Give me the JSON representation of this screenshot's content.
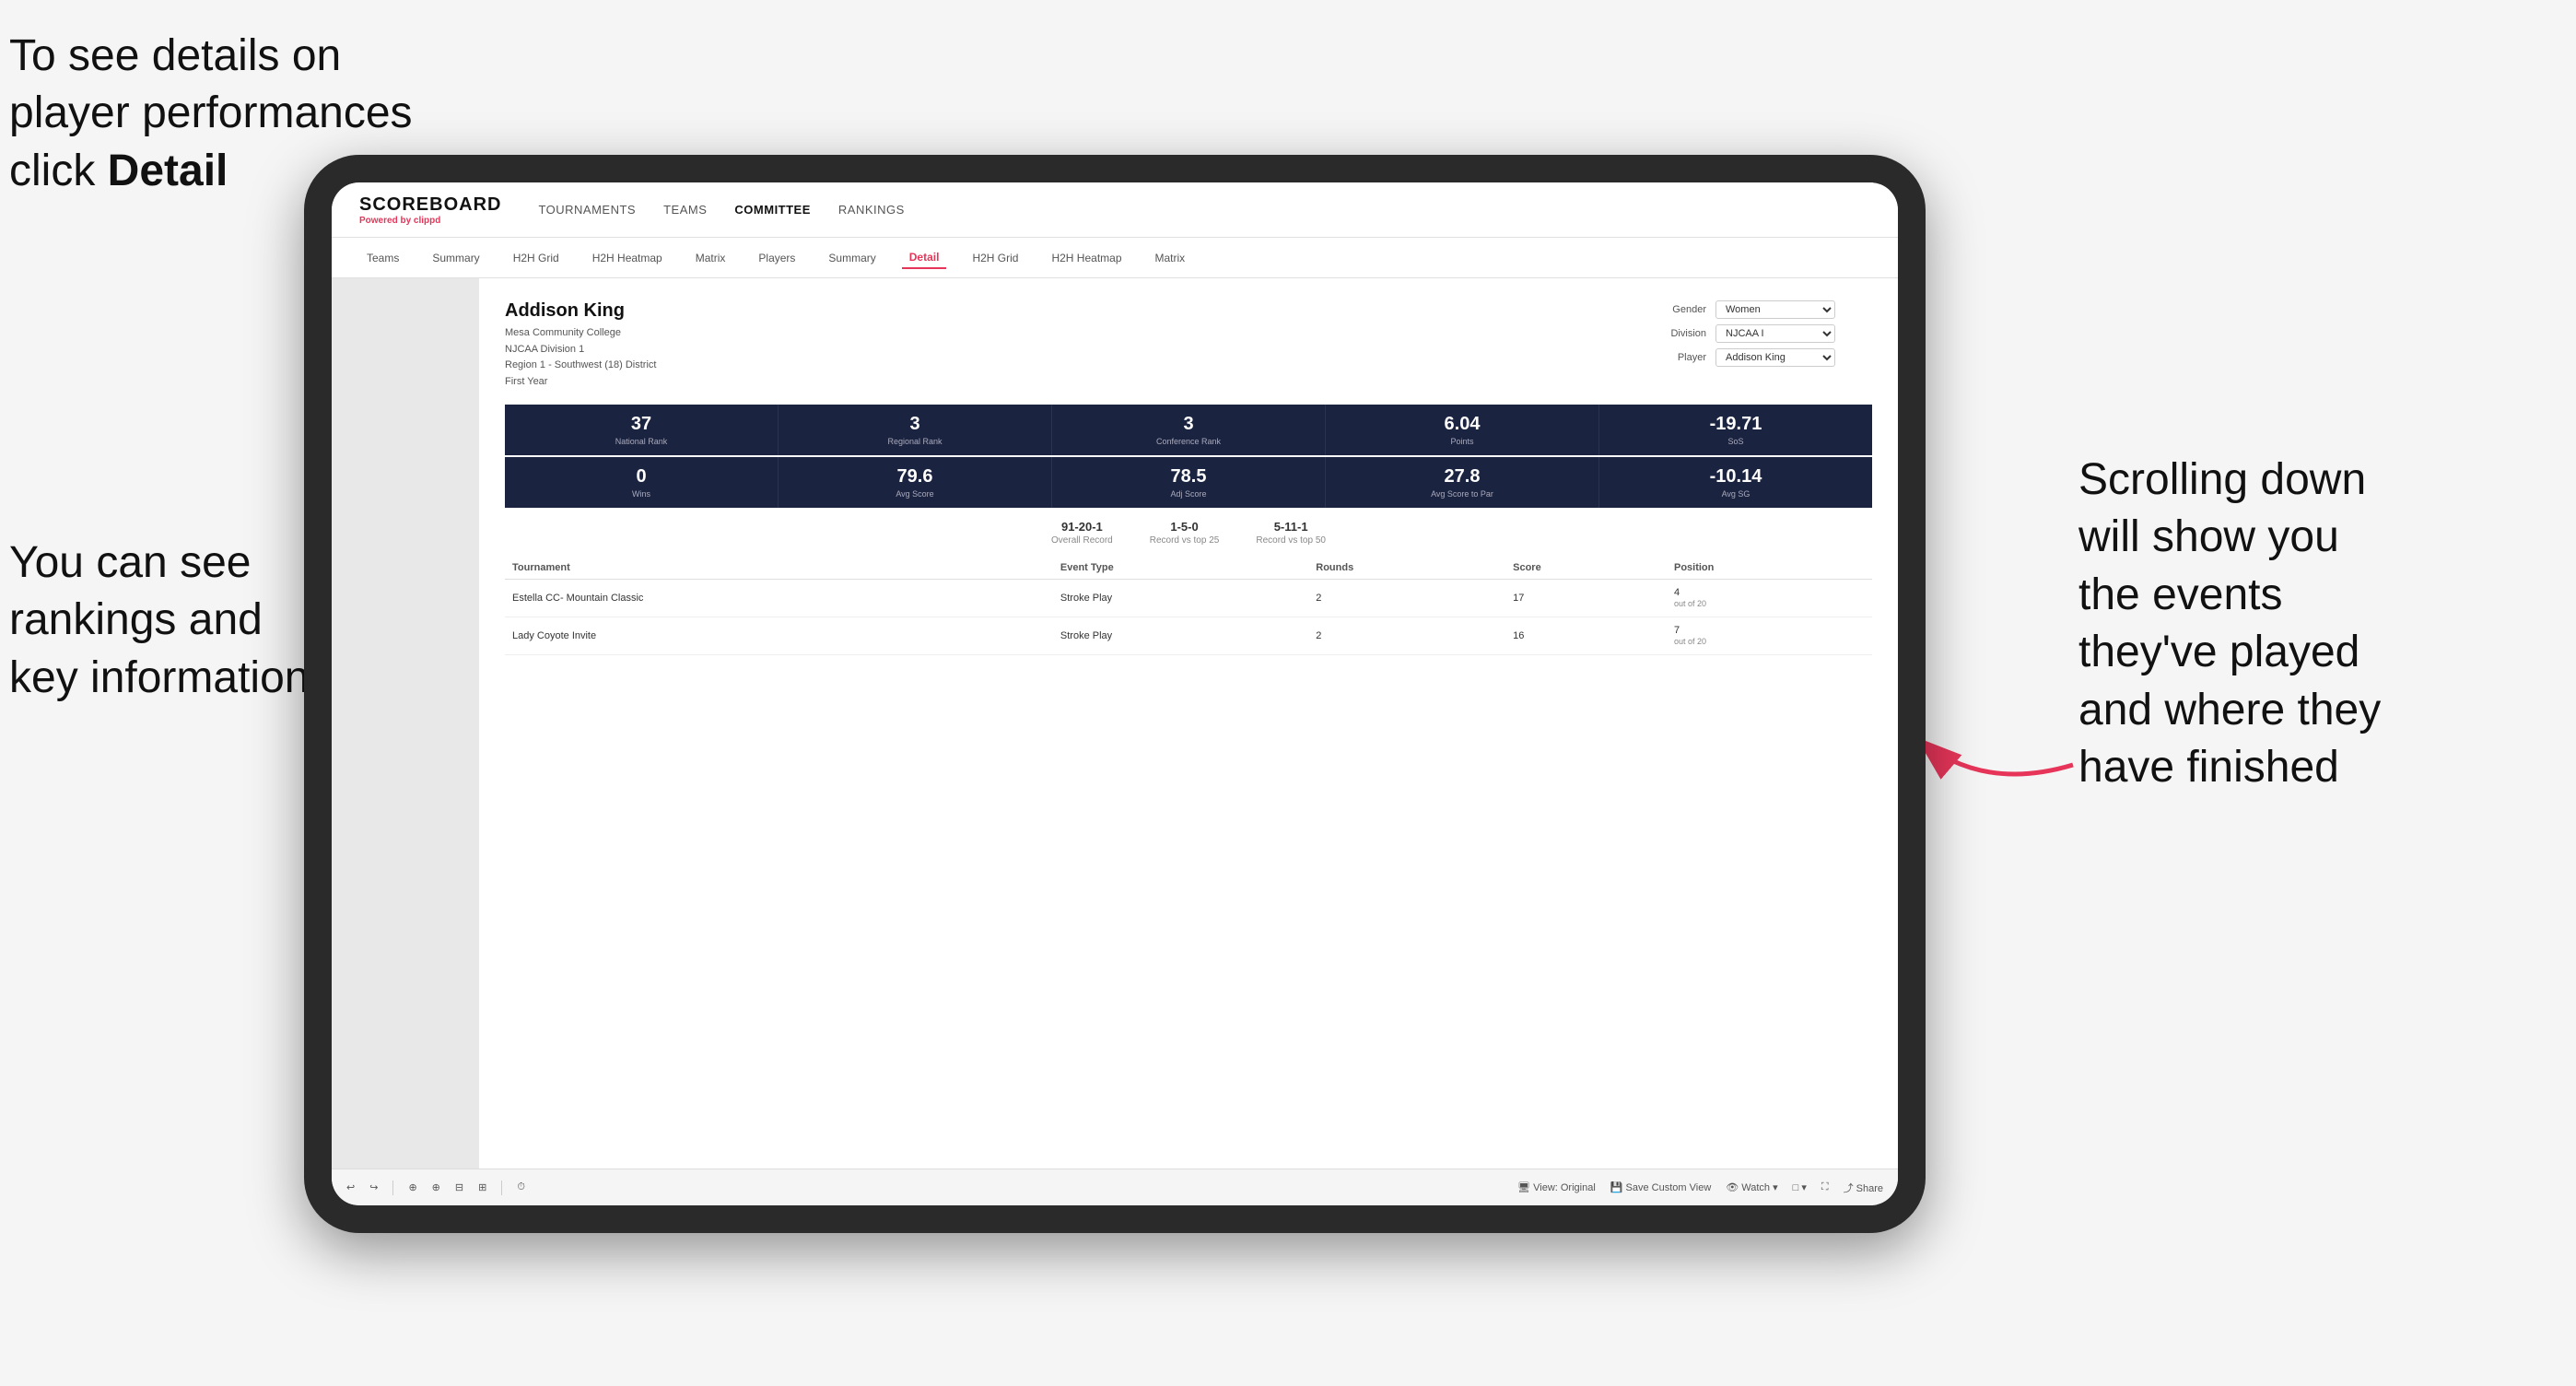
{
  "annotations": {
    "topleft": {
      "line1": "To see details on",
      "line2": "player performances",
      "line3": "click ",
      "line3bold": "Detail"
    },
    "bottomleft": {
      "line1": "You can see",
      "line2": "rankings and",
      "line3": "key information"
    },
    "right": {
      "line1": "Scrolling down",
      "line2": "will show you",
      "line3": "the events",
      "line4": "they've played",
      "line5": "and where they",
      "line6": "have finished"
    }
  },
  "nav": {
    "logo": "SCOREBOARD",
    "powered_by": "Powered by ",
    "brand": "clippd",
    "items": [
      "TOURNAMENTS",
      "TEAMS",
      "COMMITTEE",
      "RANKINGS"
    ]
  },
  "subnav": {
    "items": [
      "Teams",
      "Summary",
      "H2H Grid",
      "H2H Heatmap",
      "Matrix",
      "Players",
      "Summary",
      "Detail",
      "H2H Grid",
      "H2H Heatmap",
      "Matrix"
    ]
  },
  "player": {
    "name": "Addison King",
    "school": "Mesa Community College",
    "division": "NJCAA Division 1",
    "region": "Region 1 - Southwest (18) District",
    "year": "First Year"
  },
  "filters": {
    "gender_label": "Gender",
    "gender_value": "Women",
    "division_label": "Division",
    "division_value": "NJCAA I",
    "player_label": "Player",
    "player_value": "Addison King"
  },
  "stats_row1": [
    {
      "value": "37",
      "label": "National Rank"
    },
    {
      "value": "3",
      "label": "Regional Rank"
    },
    {
      "value": "3",
      "label": "Conference Rank"
    },
    {
      "value": "6.04",
      "label": "Points"
    },
    {
      "value": "-19.71",
      "label": "SoS"
    }
  ],
  "stats_row2": [
    {
      "value": "0",
      "label": "Wins"
    },
    {
      "value": "79.6",
      "label": "Avg Score"
    },
    {
      "value": "78.5",
      "label": "Adj Score"
    },
    {
      "value": "27.8",
      "label": "Avg Score to Par"
    },
    {
      "value": "-10.14",
      "label": "Avg SG"
    }
  ],
  "records": [
    {
      "value": "91-20-1",
      "label": "Overall Record"
    },
    {
      "value": "1-5-0",
      "label": "Record vs top 25"
    },
    {
      "value": "5-11-1",
      "label": "Record vs top 50"
    }
  ],
  "table": {
    "headers": [
      "Tournament",
      "Event Type",
      "Rounds",
      "Score",
      "Position"
    ],
    "rows": [
      {
        "tournament": "Estella CC- Mountain Classic",
        "event_type": "Stroke Play",
        "rounds": "2",
        "score": "17",
        "position": "4",
        "position_suffix": "out of 20"
      },
      {
        "tournament": "Lady Coyote Invite",
        "event_type": "Stroke Play",
        "rounds": "2",
        "score": "16",
        "position": "7",
        "position_suffix": "out of 20"
      }
    ]
  },
  "toolbar": {
    "buttons": [
      "↩",
      "↪",
      "⊕",
      "⊕",
      "⊟",
      "⊞",
      "⏱",
      "View: Original",
      "Save Custom View",
      "Watch ▾",
      "□ ▾",
      "⛶",
      "Share"
    ]
  }
}
